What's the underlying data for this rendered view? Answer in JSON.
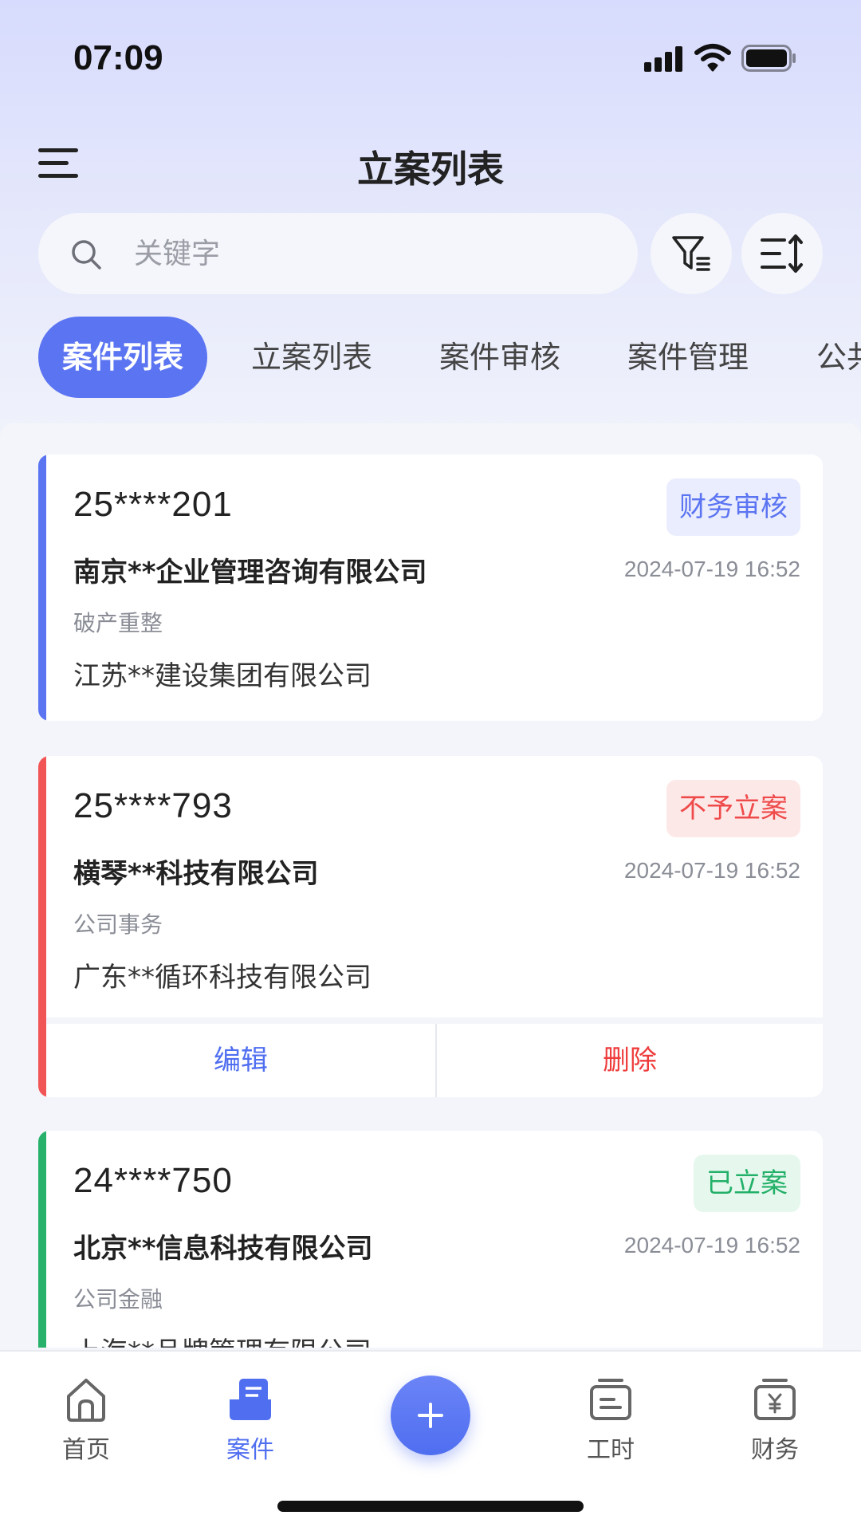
{
  "status_bar": {
    "time": "07:09"
  },
  "header": {
    "title": "立案列表",
    "menu_icon": "hamburger-icon"
  },
  "search": {
    "placeholder": "关键字",
    "filter_icon": "filter-icon",
    "sort_icon": "sort-icon"
  },
  "tabs": [
    {
      "label": "案件列表",
      "active": true
    },
    {
      "label": "立案列表",
      "active": false
    },
    {
      "label": "案件审核",
      "active": false
    },
    {
      "label": "案件管理",
      "active": false
    },
    {
      "label": "公共",
      "active": false
    }
  ],
  "cases": [
    {
      "case_no": "25****201",
      "status": "财务审核",
      "status_color": "#5b74f2",
      "status_bg": "#eaedfd",
      "stripe_color": "#5b74f2",
      "company": "南京**企业管理咨询有限公司",
      "date": "2024-07-19 16:52",
      "category": "破产重整",
      "party": "江苏**建设集团有限公司"
    },
    {
      "case_no": "25****793",
      "status": "不予立案",
      "status_color": "#ef4a4a",
      "status_bg": "#fde8e8",
      "stripe_color": "#f25555",
      "company": "横琴**科技有限公司",
      "date": "2024-07-19 16:52",
      "category": "公司事务",
      "party": "广东**循环科技有限公司",
      "actions": {
        "edit": "编辑",
        "delete": "删除",
        "edit_color": "#4f6ef0",
        "delete_color": "#ef3b3b"
      }
    },
    {
      "case_no": "24****750",
      "status": "已立案",
      "status_color": "#23b068",
      "status_bg": "#e6f8ee",
      "stripe_color": "#27b16a",
      "company": "北京**信息科技有限公司",
      "date": "2024-07-19 16:52",
      "category": "公司金融",
      "party": "上海**品牌管理有限公司"
    }
  ],
  "tabbar": {
    "items": [
      {
        "label": "首页",
        "icon": "home-icon",
        "active": false
      },
      {
        "label": "案件",
        "icon": "case-icon",
        "active": true
      },
      {
        "label": "工时",
        "icon": "timesheet-icon",
        "active": false
      },
      {
        "label": "财务",
        "icon": "finance-icon",
        "active": false
      }
    ],
    "fab_icon": "plus-icon"
  },
  "colors": {
    "accent": "#5b74f2",
    "text": "#222222",
    "muted": "#8a8d96"
  }
}
